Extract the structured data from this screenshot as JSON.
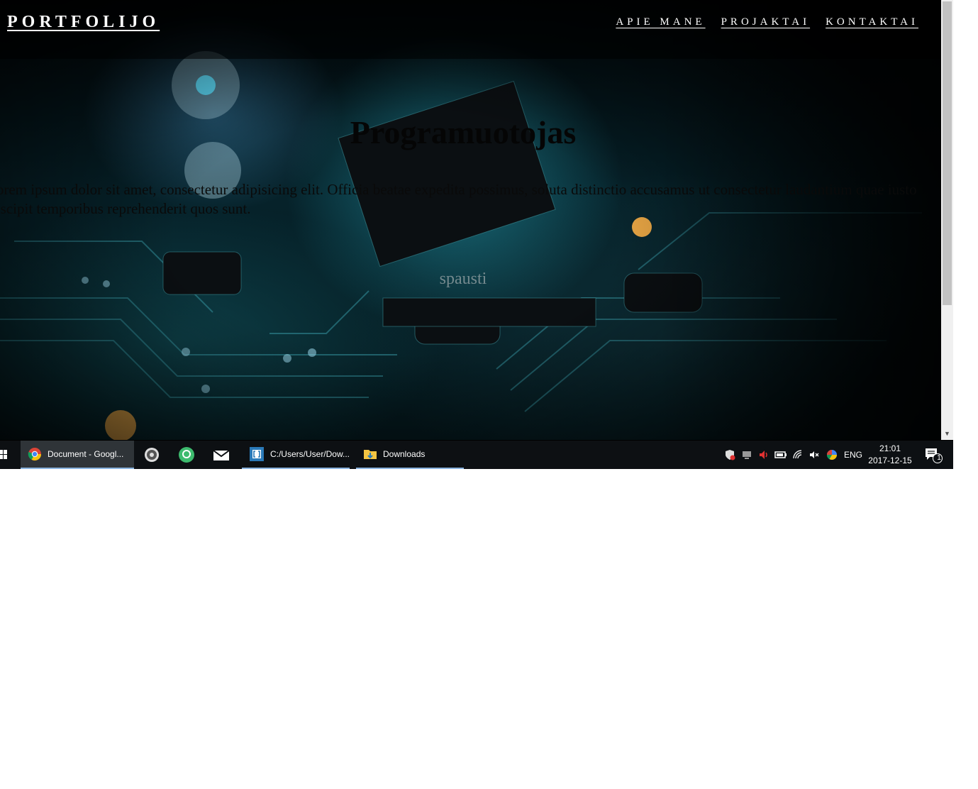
{
  "page": {
    "brand": "PORTFOLIJO",
    "nav": [
      {
        "label": "APIE MANE"
      },
      {
        "label": "PROJAKTAI"
      },
      {
        "label": "KONTAKTAI"
      }
    ],
    "hero": {
      "title": "Programuotojas",
      "text": "Lorem ipsum dolor sit amet, consectetur adipisicing elit. Officia beatae expedita possimus, soluta distinctio accusamus ut consectetur laudantium quae iusto suscipit temporibus reprehenderit quos sunt.",
      "button": "spausti"
    }
  },
  "taskbar": {
    "apps": [
      {
        "label": "Document - Googl...",
        "icon": "chrome-icon",
        "state": "active"
      },
      {
        "label": "",
        "icon": "evernote-icon",
        "state": "pinned"
      },
      {
        "label": "",
        "icon": "sourcetree-icon",
        "state": "pinned"
      },
      {
        "label": "",
        "icon": "mail-icon",
        "state": "pinned"
      },
      {
        "label": "C:/Users/User/Dow...",
        "icon": "bracket-editor-icon",
        "state": "open"
      },
      {
        "label": "Downloads",
        "icon": "folder-icon",
        "state": "open"
      }
    ],
    "tray_icons": [
      "shield-icon",
      "network-monitor-icon",
      "volume-icon",
      "battery-icon",
      "wifi-icon",
      "mute-icon",
      "color-wheel-icon"
    ],
    "language": "ENG",
    "time": "21:01",
    "date": "2017-12-15",
    "notification_count": "1"
  },
  "colors": {
    "taskbar_bg": "#0d1013",
    "accent_underline": "#8ab4e0",
    "nav_text": "#ffffff"
  }
}
